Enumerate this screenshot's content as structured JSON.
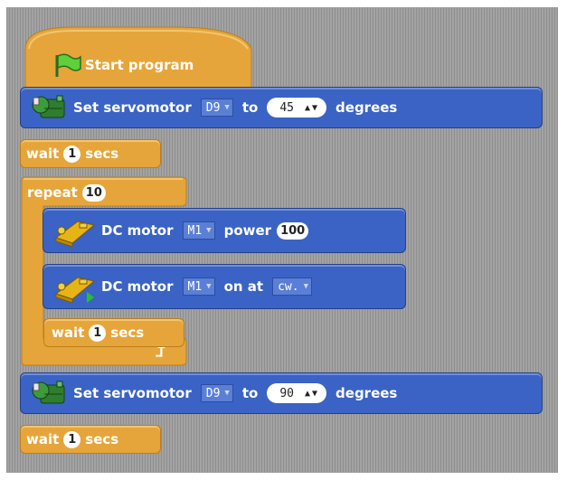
{
  "colors": {
    "control": "#e6a53a",
    "motion": "#3a63c5",
    "stage": "#9b9b9b"
  },
  "hat": {
    "icon": "green-flag-icon",
    "label": "Start program"
  },
  "servo1": {
    "icon": "servomotor-icon",
    "label": "Set servomotor",
    "port": "D9",
    "to_label": "to",
    "angle": "45",
    "unit": "degrees"
  },
  "wait1": {
    "label": "wait",
    "value": "1",
    "unit": "secs"
  },
  "repeat": {
    "label": "repeat",
    "count": "10",
    "loop_icon": "loop-arrow-icon"
  },
  "dc1": {
    "icon": "dc-motor-icon",
    "label": "DC motor",
    "motor": "M1",
    "power_label": "power",
    "power": "100"
  },
  "dc2": {
    "icon": "dc-motor-icon",
    "label": "DC motor",
    "motor": "M1",
    "on_label": "on at",
    "direction": "cw."
  },
  "wait2": {
    "label": "wait",
    "value": "1",
    "unit": "secs"
  },
  "servo2": {
    "icon": "servomotor-icon",
    "label": "Set servomotor",
    "port": "D9",
    "to_label": "to",
    "angle": "90",
    "unit": "degrees"
  },
  "wait3": {
    "label": "wait",
    "value": "1",
    "unit": "secs"
  }
}
